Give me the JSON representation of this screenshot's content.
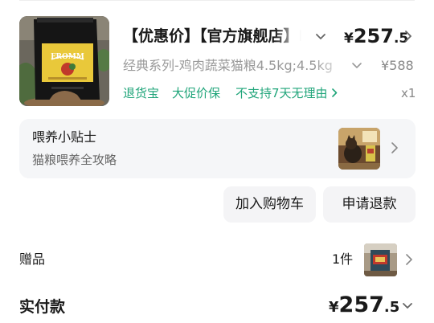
{
  "product": {
    "title": "【优惠价】【官方旗舰店】FROMM",
    "price_currency": "¥",
    "price_int": "257",
    "price_dec": ".5",
    "spec": "经典系列-鸡肉蔬菜猫粮4.5kg;4.5kg",
    "original_price": "¥588",
    "tags": [
      "退货宝",
      "大促价保",
      "不支持7天无理由"
    ],
    "quantity": "x1",
    "image_label": "FROMM"
  },
  "tips": {
    "title": "喂养小贴士",
    "subtitle": "猫粮喂养全攻略"
  },
  "actions": {
    "add_to_cart": "加入购物车",
    "request_refund": "申请退款"
  },
  "gift": {
    "label": "赠品",
    "count": "1件"
  },
  "payment": {
    "label": "实付款",
    "currency": "¥",
    "int": "257",
    "dec": ".5"
  },
  "colors": {
    "accent_green": "#20a57a",
    "text": "#1a1a1a",
    "muted": "#999999",
    "card_bg": "#f5f6f8"
  }
}
